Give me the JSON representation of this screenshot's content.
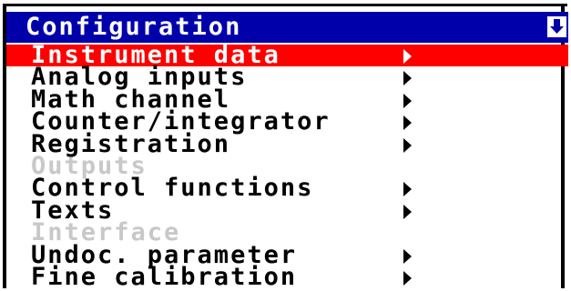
{
  "header": {
    "title": "Configuration",
    "scroll_icon": "scroll-down-arrow-icon"
  },
  "colors": {
    "header_background": "#0000aa",
    "selection_background": "#ff0000",
    "selected_text": "#ffffff",
    "enabled_text": "#000000",
    "disabled_text": "#c8c8c8"
  },
  "menu": {
    "items": [
      {
        "label": "Instrument data",
        "has_submenu": true,
        "enabled": true,
        "selected": true
      },
      {
        "label": "Analog inputs",
        "has_submenu": true,
        "enabled": true,
        "selected": false
      },
      {
        "label": "Math channel",
        "has_submenu": true,
        "enabled": true,
        "selected": false
      },
      {
        "label": "Counter/integrator",
        "has_submenu": true,
        "enabled": true,
        "selected": false
      },
      {
        "label": "Registration",
        "has_submenu": true,
        "enabled": true,
        "selected": false
      },
      {
        "label": "Outputs",
        "has_submenu": false,
        "enabled": false,
        "selected": false
      },
      {
        "label": "Control functions",
        "has_submenu": true,
        "enabled": true,
        "selected": false
      },
      {
        "label": "Texts",
        "has_submenu": true,
        "enabled": true,
        "selected": false
      },
      {
        "label": "Interface",
        "has_submenu": false,
        "enabled": false,
        "selected": false
      },
      {
        "label": "Undoc. parameter",
        "has_submenu": true,
        "enabled": true,
        "selected": false
      },
      {
        "label": "Fine calibration",
        "has_submenu": true,
        "enabled": true,
        "selected": false
      }
    ]
  }
}
